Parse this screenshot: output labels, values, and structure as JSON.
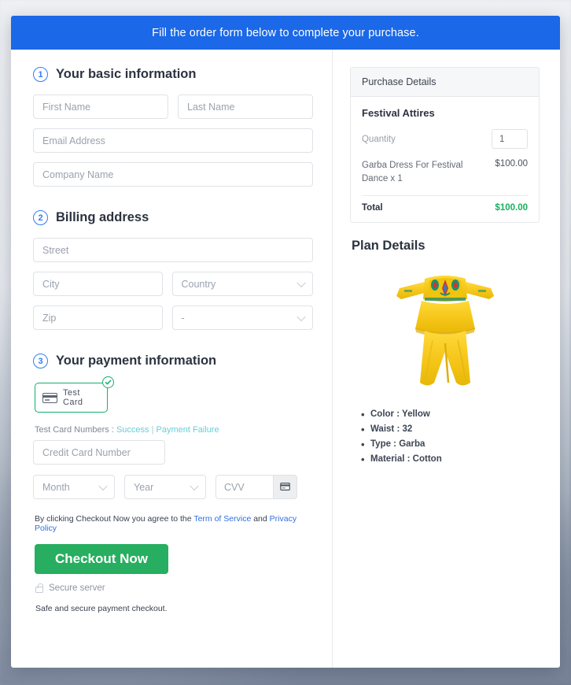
{
  "banner": {
    "text": "Fill the order form below to complete your purchase."
  },
  "sections": {
    "basic": {
      "step": "1",
      "title": "Your basic information",
      "fields": {
        "first_name": "First Name",
        "last_name": "Last Name",
        "email": "Email Address",
        "company": "Company Name"
      }
    },
    "billing": {
      "step": "2",
      "title": "Billing address",
      "fields": {
        "street": "Street",
        "city": "City",
        "country": "Country",
        "zip": "Zip",
        "state": "-"
      }
    },
    "payment": {
      "step": "3",
      "title": "Your payment information",
      "card_tile_label": "Test  Card",
      "test_numbers_label": "Test Card Numbers :",
      "test_success_link": "Success",
      "test_separator": "|",
      "test_failure_link": "Payment Failure",
      "credit_card_number": "Credit Card Number",
      "month": "Month",
      "year": "Year",
      "cvv": "CVV"
    }
  },
  "terms": {
    "prefix": "By clicking Checkout Now you agree to the",
    "tos_link": "Term of Service",
    "conjunction": "and",
    "privacy_link": "Privacy Policy"
  },
  "checkout": {
    "button_label": "Checkout Now",
    "secure_server": "Secure server",
    "safe_note": "Safe and secure payment checkout."
  },
  "purchase": {
    "header": "Purchase Details",
    "product_group": "Festival Attires",
    "quantity_label": "Quantity",
    "quantity_value": "1",
    "line_item_name": "Garba Dress For Festival Dance x 1",
    "line_item_price": "$100.00",
    "total_label": "Total",
    "total_value": "$100.00"
  },
  "plan": {
    "title": "Plan Details",
    "image_alt": "yellow-garba-dress",
    "attributes": [
      "Color : Yellow",
      "Waist : 32",
      "Type : Garba",
      "Material  : Cotton"
    ]
  },
  "colors": {
    "banner_blue": "#1b68e8",
    "step_blue": "#2f7cf6",
    "checkout_green": "#27ae60",
    "total_green": "#18b05f",
    "card_select_green": "#13b06b",
    "link_blue": "#2f6fe0",
    "test_link_teal": "#63cfd8"
  }
}
